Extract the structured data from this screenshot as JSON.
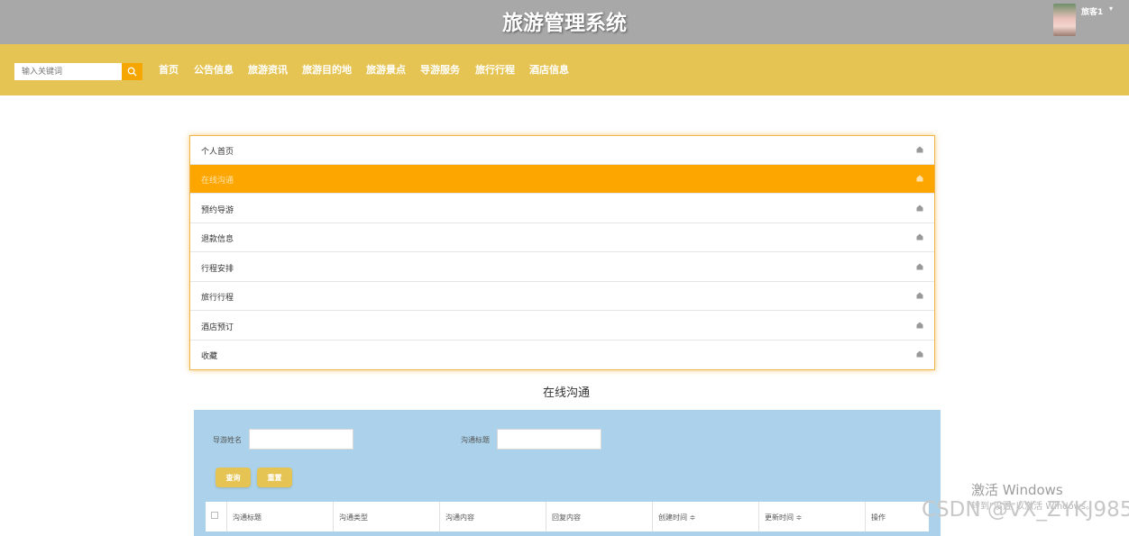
{
  "header": {
    "title": "旅游管理系统",
    "user_name": "旅客1",
    "user_caret": "▾"
  },
  "nav": {
    "search_placeholder": "输入关键词",
    "items": [
      "首页",
      "公告信息",
      "旅游资讯",
      "旅游目的地",
      "旅游景点",
      "导游服务",
      "旅行行程",
      "酒店信息"
    ]
  },
  "menu": {
    "items": [
      {
        "label": "个人首页",
        "active": false
      },
      {
        "label": "在线沟通",
        "active": true
      },
      {
        "label": "预约导游",
        "active": false
      },
      {
        "label": "退款信息",
        "active": false
      },
      {
        "label": "行程安排",
        "active": false
      },
      {
        "label": "旅行行程",
        "active": false
      },
      {
        "label": "酒店预订",
        "active": false
      },
      {
        "label": "收藏",
        "active": false
      }
    ]
  },
  "section": {
    "title": "在线沟通"
  },
  "filters": {
    "guide_name_label": "导游姓名",
    "chat_title_label": "沟通标题",
    "query_button": "查询",
    "reset_button": "重置"
  },
  "table": {
    "columns": [
      "沟通标题",
      "沟通类型",
      "沟通内容",
      "回复内容",
      "创建时间 ≑",
      "更新时间 ≑",
      "操作"
    ]
  },
  "watermark": {
    "activate": "激活 Windows",
    "activate_hint": "转到\"设置\"以激活 Windows。",
    "csdn": "CSDN @VX_ZYKJ985"
  },
  "colors": {
    "topbar": "#a8a8a8",
    "navbar": "#e6c453",
    "accent": "#fea600",
    "panel": "#abd2ea"
  }
}
